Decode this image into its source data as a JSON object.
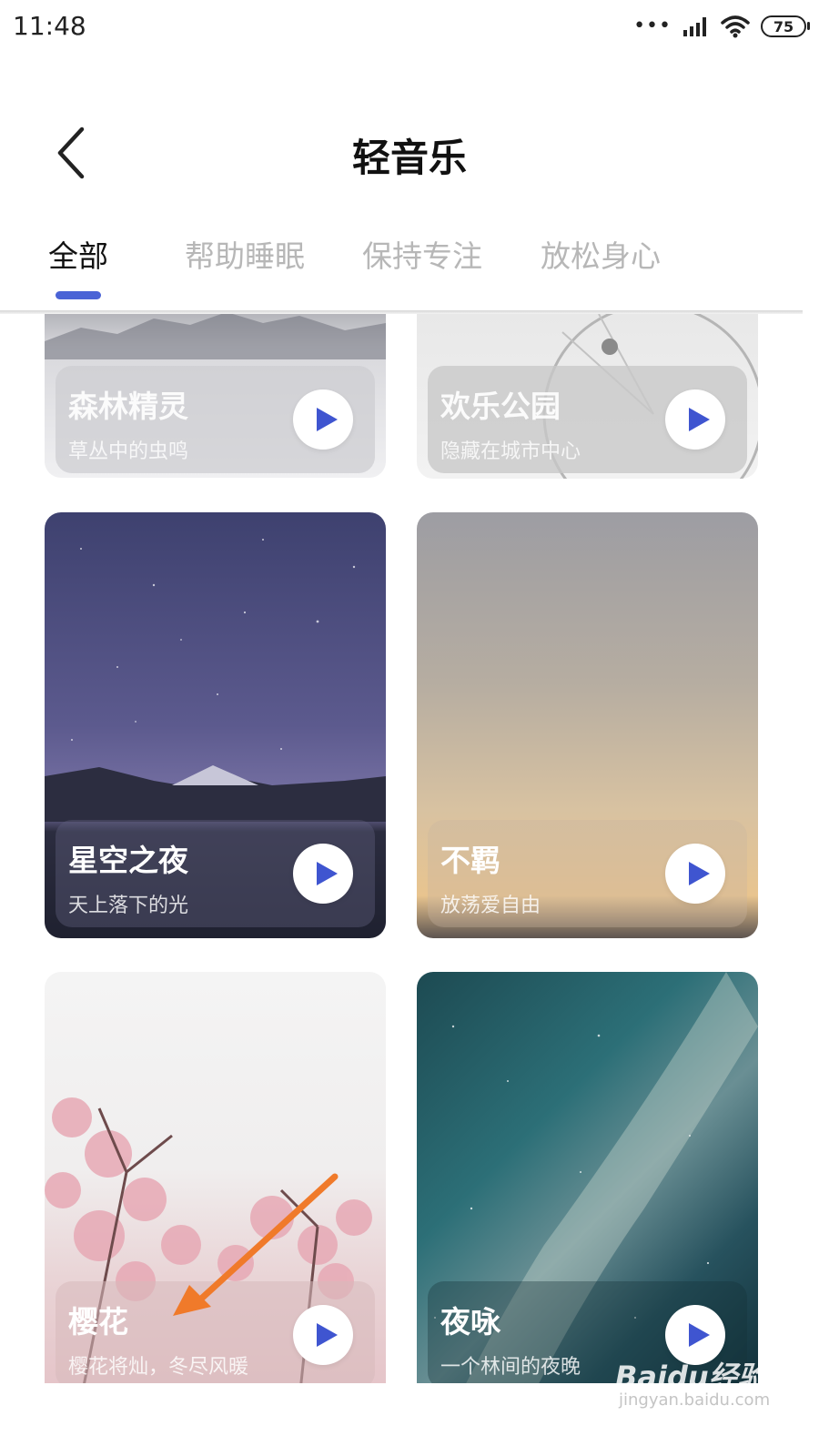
{
  "status_bar": {
    "time": "11:48",
    "dots": "•••",
    "battery": "75"
  },
  "header": {
    "title": "轻音乐"
  },
  "tabs": [
    {
      "label": "全部",
      "active": true
    },
    {
      "label": "帮助睡眠",
      "active": false
    },
    {
      "label": "保持专注",
      "active": false
    },
    {
      "label": "放松身心",
      "active": false
    }
  ],
  "tab_underline_color": "#4a63d6",
  "play_icon_color": "#3f55d0",
  "cards": [
    {
      "title": "森林精灵",
      "subtitle": "草丛中的虫鸣"
    },
    {
      "title": "欢乐公园",
      "subtitle": "隐藏在城市中心"
    },
    {
      "title": "星空之夜",
      "subtitle": "天上落下的光"
    },
    {
      "title": "不羁",
      "subtitle": "放荡爱自由"
    },
    {
      "title": "樱花",
      "subtitle": "樱花将灿，冬尽风暖"
    },
    {
      "title": "夜咏",
      "subtitle": "一个林间的夜晚"
    }
  ],
  "watermark": {
    "brand": "Baidu经验",
    "url": "jingyan.baidu.com"
  }
}
